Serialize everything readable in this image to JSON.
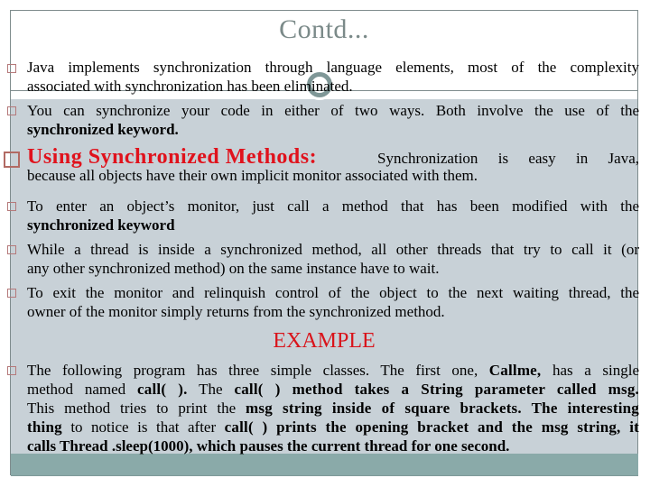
{
  "slide": {
    "title": "Contd...",
    "bullets": [
      {
        "line1": "Java implements synchronization through language elements, most of the complexity",
        "line2": "associated with synchronization has been eliminated."
      },
      {
        "line1": " You can synchronize your code in either of two ways. Both involve the use of the",
        "line2": "synchronized keyword."
      },
      {
        "heading": "Using Synchronized Methods:",
        "line1_rest": "Synchronization is easy in Java,",
        "line2": "because all objects have their own implicit monitor associated with them."
      },
      {
        "line1": "To enter an object’s monitor, just call a method that has been modified with the",
        "line2": "synchronized keyword"
      },
      {
        "line1": "While a thread is inside a synchronized method, all other threads that try to call it (or",
        "line2": "any other synchronized method) on the same instance have to wait."
      },
      {
        "line1": "To exit the monitor and relinquish control of the object to the next waiting thread, the",
        "line2": "owner of the monitor simply returns from the synchronized method."
      }
    ],
    "example_heading": "EXAMPLE",
    "example": {
      "l1_a": "The following program has three simple classes. The first one, ",
      "l1_b": "Callme,",
      "l1_c": " has a single",
      "l2_a": "method named ",
      "l2_b": "call( ).",
      "l2_c": " The ",
      "l2_d": "call( ) method takes a String parameter called msg.",
      "l3_a": "This method tries to print the ",
      "l3_b": "msg string inside of square brackets. The interesting",
      "l4_a": "thing",
      "l4_b": " to notice is that after ",
      "l4_c": "call( ) prints the opening bracket and the msg string, it",
      "l5": "calls Thread .sleep(1000), which pauses the current thread for one second."
    }
  },
  "colors": {
    "title": "#7b8a89",
    "heading_red": "#e0121c",
    "panel": "#c8d1d7",
    "footer_band": "#8aaaa9",
    "bullet_border": "#b5797a"
  }
}
